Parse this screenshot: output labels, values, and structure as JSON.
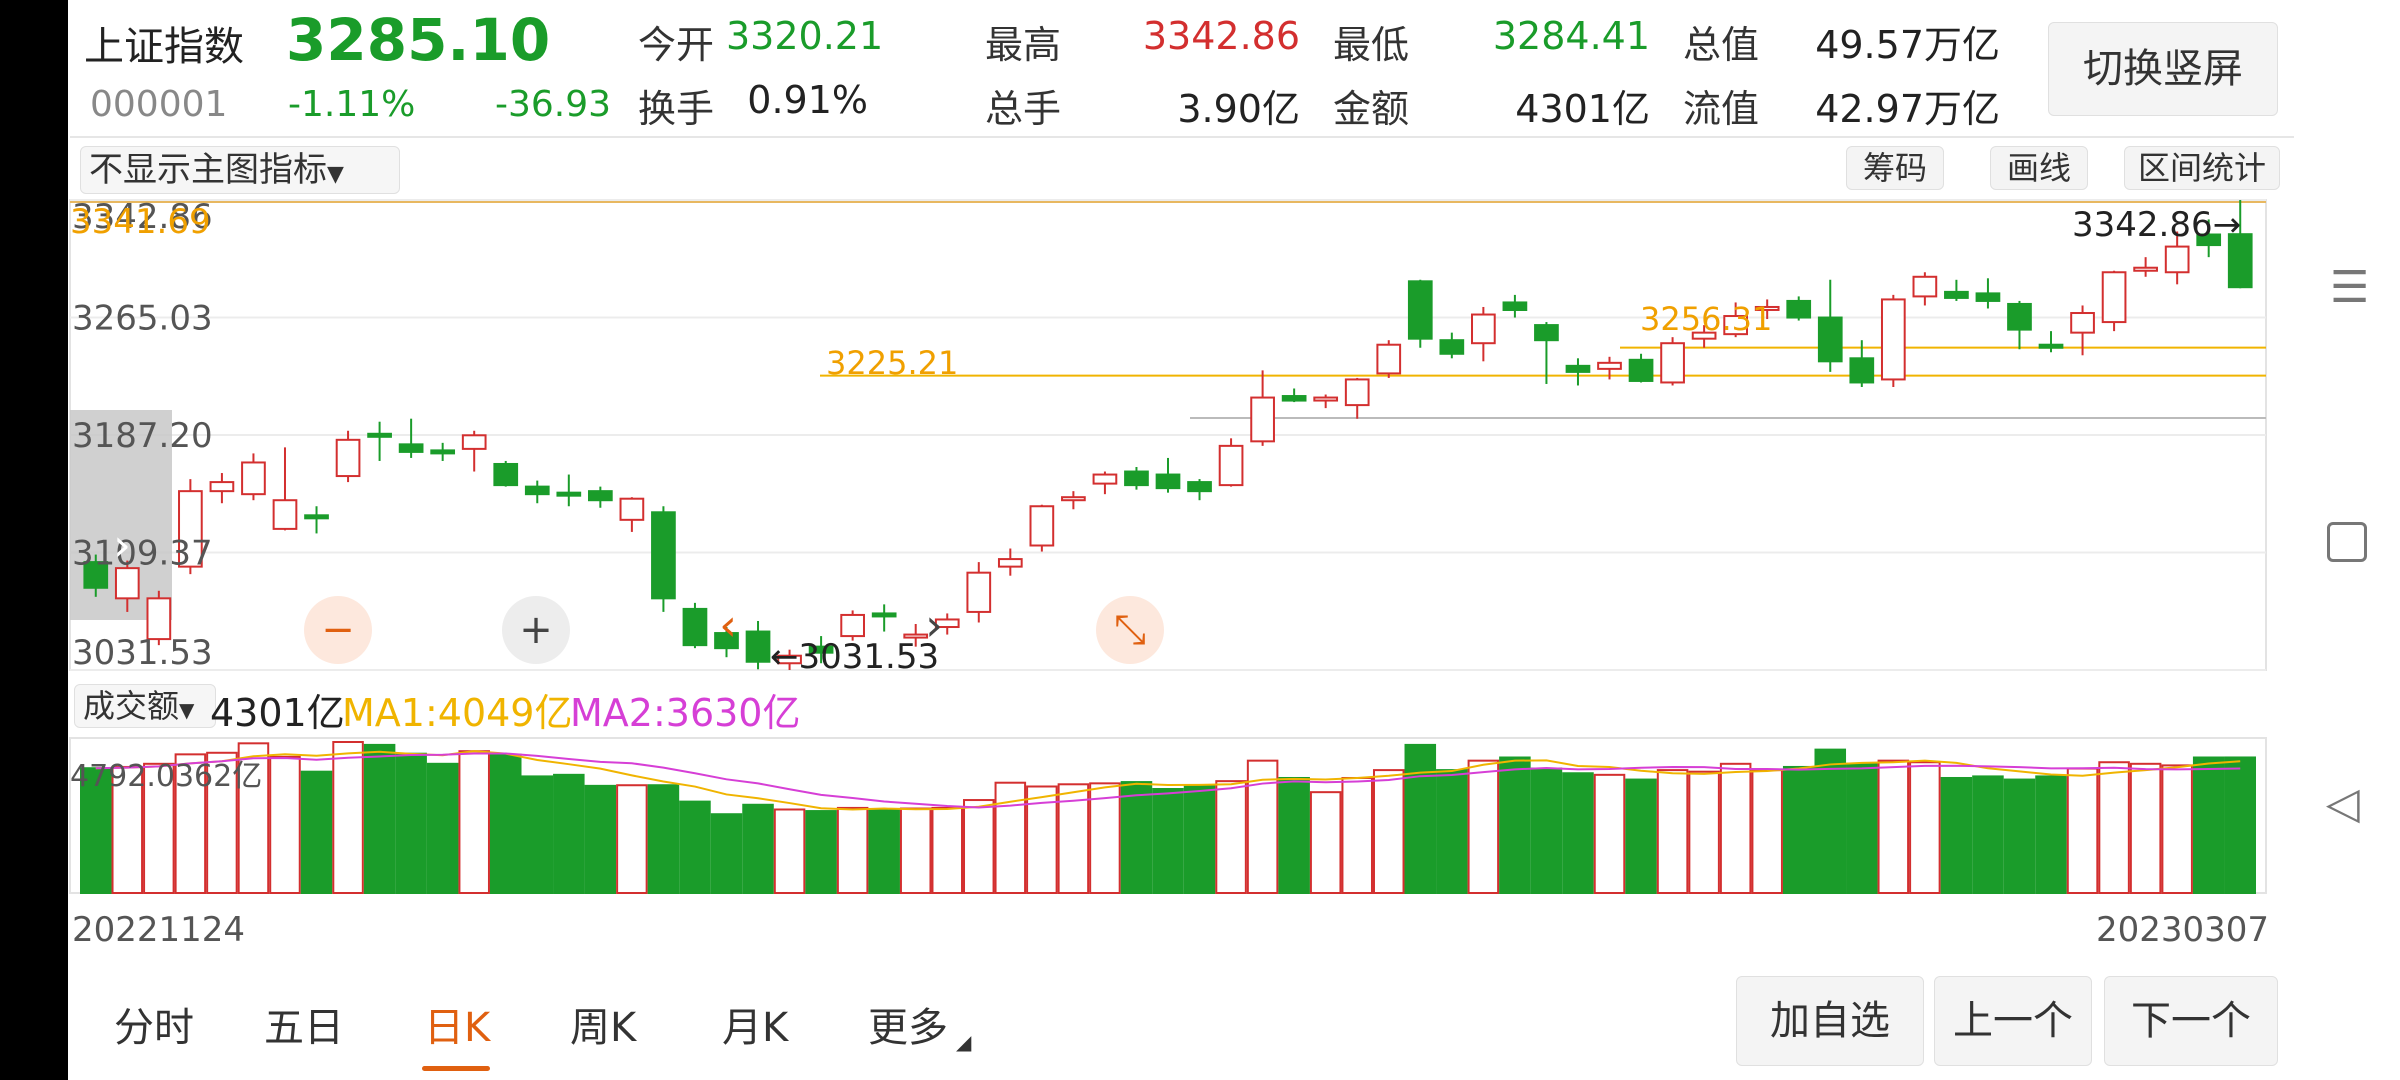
{
  "header": {
    "name": "上证指数",
    "code": "000001",
    "price": "3285.10",
    "change_pct": "-1.11%",
    "change": "-36.93",
    "switch_label": "切换竖屏"
  },
  "quotes": [
    {
      "label": "今开",
      "value": "3320.21",
      "color": "green"
    },
    {
      "label": "最高",
      "value": "3342.86",
      "color": "red"
    },
    {
      "label": "最低",
      "value": "3284.41",
      "color": "green"
    },
    {
      "label": "总值",
      "value": "49.57万亿",
      "color": "normal"
    },
    {
      "label": "换手",
      "value": "0.91%",
      "color": "normal"
    },
    {
      "label": "总手",
      "value": "3.90亿",
      "color": "normal"
    },
    {
      "label": "金额",
      "value": "4301亿",
      "color": "normal"
    },
    {
      "label": "流值",
      "value": "42.97万亿",
      "color": "normal"
    }
  ],
  "toolbar": {
    "indicator_select": "不显示主图指标",
    "buttons": [
      "筹码",
      "画线",
      "区间统计"
    ]
  },
  "price_chart": {
    "y_labels": [
      "3342.86",
      "3265.03",
      "3187.20",
      "3109.37",
      "3031.53"
    ],
    "overlay_label": "3341.69",
    "high_marker": "3342.86",
    "low_marker": "3031.53",
    "line_labels": [
      "3225.21",
      "3256.31"
    ]
  },
  "volume": {
    "select_label": "成交额",
    "value": "4301亿",
    "ma1": "MA1:4049亿",
    "ma2": "MA2:3630亿",
    "axis_max": "4792.0362亿"
  },
  "dates": {
    "start": "20221124",
    "end": "20230307"
  },
  "tabs": [
    "分时",
    "五日",
    "日K",
    "周K",
    "月K",
    "更多"
  ],
  "active_tab": 2,
  "nav_buttons": [
    "加自选",
    "上一个",
    "下一个"
  ],
  "chart_data": {
    "type": "candlestick",
    "ylim": [
      3031.53,
      3342.86
    ],
    "candles": [
      {
        "o": 3103,
        "c": 3086,
        "h": 3108,
        "l": 3080,
        "v": 3960
      },
      {
        "o": 3079,
        "c": 3099,
        "h": 3104,
        "l": 3070,
        "v": 4000
      },
      {
        "o": 3052,
        "c": 3079,
        "h": 3084,
        "l": 3048,
        "v": 4100
      },
      {
        "o": 3100,
        "c": 3150,
        "h": 3158,
        "l": 3095,
        "v": 4400
      },
      {
        "o": 3150,
        "c": 3156,
        "h": 3162,
        "l": 3142,
        "v": 4450
      },
      {
        "o": 3148,
        "c": 3169,
        "h": 3175,
        "l": 3144,
        "v": 4750
      },
      {
        "o": 3125,
        "c": 3144,
        "h": 3179,
        "l": 3124,
        "v": 4320
      },
      {
        "o": 3134,
        "c": 3132,
        "h": 3140,
        "l": 3122,
        "v": 3850
      },
      {
        "o": 3160,
        "c": 3184,
        "h": 3190,
        "l": 3156,
        "v": 4792
      },
      {
        "o": 3188,
        "c": 3186,
        "h": 3196,
        "l": 3170,
        "v": 4700
      },
      {
        "o": 3181,
        "c": 3176,
        "h": 3198,
        "l": 3172,
        "v": 4420
      },
      {
        "o": 3177,
        "c": 3176,
        "h": 3182,
        "l": 3170,
        "v": 4100
      },
      {
        "o": 3178,
        "c": 3187,
        "h": 3190,
        "l": 3163,
        "v": 4500
      },
      {
        "o": 3168,
        "c": 3154,
        "h": 3170,
        "l": 3153,
        "v": 4390
      },
      {
        "o": 3153,
        "c": 3148,
        "h": 3157,
        "l": 3142,
        "v": 3700
      },
      {
        "o": 3149,
        "c": 3147,
        "h": 3161,
        "l": 3140,
        "v": 3750
      },
      {
        "o": 3150,
        "c": 3144,
        "h": 3153,
        "l": 3139,
        "v": 3400
      },
      {
        "o": 3131,
        "c": 3145,
        "h": 3146,
        "l": 3123,
        "v": 3420
      },
      {
        "o": 3136,
        "c": 3079,
        "h": 3140,
        "l": 3070,
        "v": 3420
      },
      {
        "o": 3072,
        "c": 3048,
        "h": 3076,
        "l": 3046,
        "v": 2900
      },
      {
        "o": 3056,
        "c": 3046,
        "h": 3060,
        "l": 3040,
        "v": 2500
      },
      {
        "o": 3057,
        "c": 3037,
        "h": 3064,
        "l": 3032,
        "v": 2800
      },
      {
        "o": 3036,
        "c": 3041,
        "h": 3045,
        "l": 3031.53,
        "v": 2650
      },
      {
        "o": 3047,
        "c": 3043,
        "h": 3054,
        "l": 3036,
        "v": 2600
      },
      {
        "o": 3054,
        "c": 3068,
        "h": 3071,
        "l": 3051,
        "v": 2700
      },
      {
        "o": 3069,
        "c": 3068,
        "h": 3075,
        "l": 3057,
        "v": 2650
      },
      {
        "o": 3054,
        "c": 3055,
        "h": 3062,
        "l": 3047,
        "v": 2680
      },
      {
        "o": 3060,
        "c": 3065,
        "h": 3069,
        "l": 3055,
        "v": 2700
      },
      {
        "o": 3070,
        "c": 3096,
        "h": 3103,
        "l": 3063,
        "v": 2950
      },
      {
        "o": 3100,
        "c": 3105,
        "h": 3112,
        "l": 3094,
        "v": 3500
      },
      {
        "o": 3114,
        "c": 3140,
        "h": 3141,
        "l": 3110,
        "v": 3380
      },
      {
        "o": 3144,
        "c": 3146,
        "h": 3150,
        "l": 3138,
        "v": 3450
      },
      {
        "o": 3155,
        "c": 3161,
        "h": 3163,
        "l": 3148,
        "v": 3480
      },
      {
        "o": 3163,
        "c": 3154,
        "h": 3166,
        "l": 3151,
        "v": 3520
      },
      {
        "o": 3161,
        "c": 3152,
        "h": 3172,
        "l": 3149,
        "v": 3300
      },
      {
        "o": 3156,
        "c": 3150,
        "h": 3158,
        "l": 3144,
        "v": 3400
      },
      {
        "o": 3154,
        "c": 3180,
        "h": 3185,
        "l": 3153,
        "v": 3550
      },
      {
        "o": 3183,
        "c": 3212,
        "h": 3230,
        "l": 3180,
        "v": 4200
      },
      {
        "o": 3213,
        "c": 3210,
        "h": 3218,
        "l": 3209,
        "v": 3650
      },
      {
        "o": 3211,
        "c": 3212,
        "h": 3214,
        "l": 3205,
        "v": 3200
      },
      {
        "o": 3207,
        "c": 3224,
        "h": 3225,
        "l": 3198,
        "v": 3650
      },
      {
        "o": 3228,
        "c": 3247,
        "h": 3250,
        "l": 3225,
        "v": 3900
      },
      {
        "o": 3289,
        "c": 3251,
        "h": 3290,
        "l": 3245,
        "v": 4700
      },
      {
        "o": 3250,
        "c": 3241,
        "h": 3255,
        "l": 3238,
        "v": 3900
      },
      {
        "o": 3248,
        "c": 3267,
        "h": 3272,
        "l": 3236,
        "v": 4200
      },
      {
        "o": 3275,
        "c": 3270,
        "h": 3280,
        "l": 3265,
        "v": 4300
      },
      {
        "o": 3260,
        "c": 3250,
        "h": 3262,
        "l": 3221,
        "v": 3950
      },
      {
        "o": 3233,
        "c": 3229,
        "h": 3238,
        "l": 3220,
        "v": 3800
      },
      {
        "o": 3231,
        "c": 3235,
        "h": 3239,
        "l": 3224,
        "v": 3750
      },
      {
        "o": 3237,
        "c": 3223,
        "h": 3241,
        "l": 3222,
        "v": 3600
      },
      {
        "o": 3222,
        "c": 3248,
        "h": 3252,
        "l": 3220,
        "v": 3900
      },
      {
        "o": 3251,
        "c": 3255,
        "h": 3260,
        "l": 3245,
        "v": 3850
      },
      {
        "o": 3254,
        "c": 3266,
        "h": 3275,
        "l": 3252,
        "v": 4100
      },
      {
        "o": 3271,
        "c": 3272,
        "h": 3277,
        "l": 3264,
        "v": 3900
      },
      {
        "o": 3276,
        "c": 3265,
        "h": 3279,
        "l": 3263,
        "v": 4000
      },
      {
        "o": 3265,
        "c": 3236,
        "h": 3290,
        "l": 3229,
        "v": 4550
      },
      {
        "o": 3238,
        "c": 3222,
        "h": 3250,
        "l": 3219,
        "v": 4100
      },
      {
        "o": 3224,
        "c": 3277,
        "h": 3280,
        "l": 3219,
        "v": 4200
      },
      {
        "o": 3279,
        "c": 3292,
        "h": 3295,
        "l": 3273,
        "v": 4150
      },
      {
        "o": 3282,
        "c": 3278,
        "h": 3290,
        "l": 3276,
        "v": 3650
      },
      {
        "o": 3281,
        "c": 3276,
        "h": 3291,
        "l": 3271,
        "v": 3700
      },
      {
        "o": 3274,
        "c": 3257,
        "h": 3276,
        "l": 3244,
        "v": 3600
      },
      {
        "o": 3247,
        "c": 3245,
        "h": 3256,
        "l": 3242,
        "v": 3700
      },
      {
        "o": 3255,
        "c": 3268,
        "h": 3273,
        "l": 3240,
        "v": 3950
      },
      {
        "o": 3262,
        "c": 3295,
        "h": 3296,
        "l": 3256,
        "v": 4150
      },
      {
        "o": 3296,
        "c": 3298,
        "h": 3305,
        "l": 3292,
        "v": 4100
      },
      {
        "o": 3295,
        "c": 3312,
        "h": 3322,
        "l": 3287,
        "v": 4050
      },
      {
        "o": 3320,
        "c": 3313,
        "h": 3330,
        "l": 3305,
        "v": 4300
      },
      {
        "o": 3320.21,
        "c": 3285.1,
        "h": 3342.86,
        "l": 3284.41,
        "v": 4301
      }
    ],
    "ma_price": [
      {
        "name": "mark_3225",
        "value": 3225.21
      },
      {
        "name": "mark_3256",
        "value": 3256.31
      }
    ]
  },
  "side_icons": [
    "menu-icon",
    "square-icon",
    "back-icon"
  ]
}
